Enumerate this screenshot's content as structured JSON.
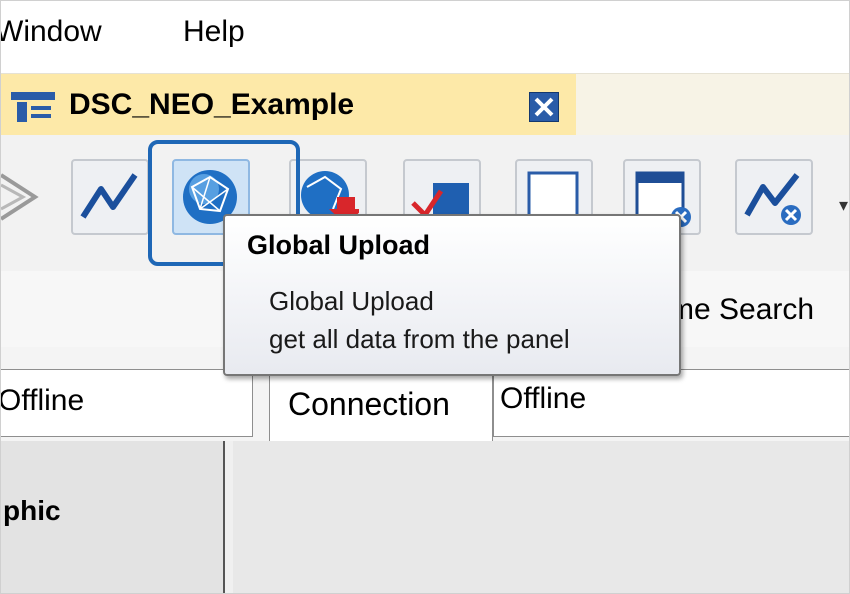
{
  "menu": {
    "window_label": "Window",
    "help_label": "Help"
  },
  "document_tab": {
    "title": "DSC_NEO_Example"
  },
  "toolbar": {
    "highlight_color": "#1e67b6",
    "buttons": [
      {
        "name": "partial-icon"
      },
      {
        "name": "graph-icon"
      },
      {
        "name": "global-upload-icon"
      },
      {
        "name": "global-download-icon"
      },
      {
        "name": "checkmark-icon"
      },
      {
        "name": "blank-window-icon"
      },
      {
        "name": "window-close-icon"
      },
      {
        "name": "graph-close-icon"
      }
    ]
  },
  "tooltip": {
    "title": "Global Upload",
    "line1": "Global Upload",
    "line2": "get all data from the panel"
  },
  "search": {
    "label": "me Search"
  },
  "connection": {
    "left_value": "Offline",
    "tab_label": "Connection",
    "right_value": "Offline"
  },
  "left_pane": {
    "label": "phic"
  }
}
